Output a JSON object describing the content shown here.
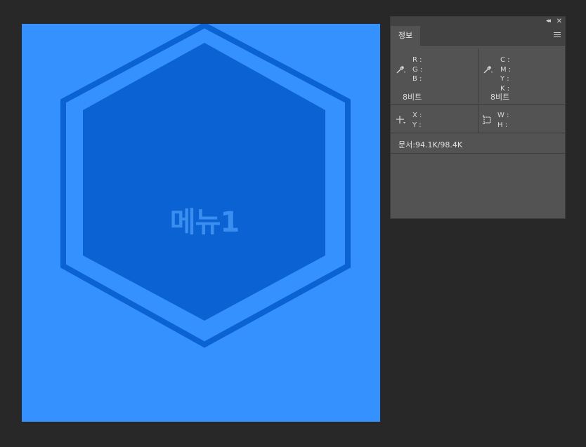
{
  "canvas": {
    "background": "#3591fd",
    "hex_outer_color": "#0b63d3",
    "hex_inner_color": "#0b63d3",
    "label": "메뉴1"
  },
  "panel": {
    "tab_label": "정보",
    "collapse_glyph": "◂◂",
    "close_glyph": "✕",
    "left_channels": [
      "R :",
      "G :",
      "B :"
    ],
    "right_channels": [
      "C :",
      "M :",
      "Y :",
      "K :"
    ],
    "left_bits": "8비트",
    "right_bits": "8비트",
    "position_lines": [
      "X :",
      "Y :"
    ],
    "size_lines": [
      "W :",
      "H :"
    ],
    "doc_info": "문서:94.1K/98.4K",
    "icons": {
      "left_sampler": "eyedropper-icon",
      "right_sampler": "eyedropper-icon",
      "position": "crosshair-icon",
      "size": "selection-rect-icon",
      "menu": "panel-menu-icon"
    }
  }
}
